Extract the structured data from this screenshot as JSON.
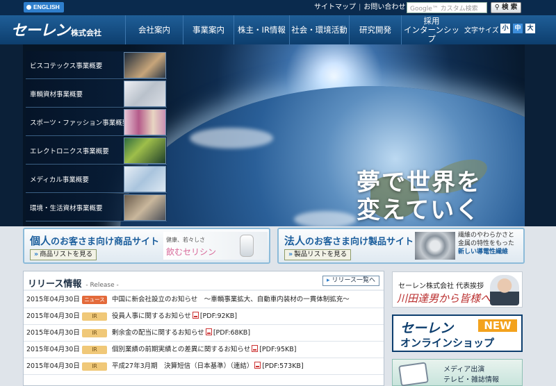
{
  "topbar": {
    "lang_label": "ENGLISH",
    "sitemap": "サイトマップ",
    "contact": "お問い合わせ",
    "search_placeholder": "Google™ カスタム検索",
    "search_button": "検 索"
  },
  "header": {
    "logo_main": "セーレン",
    "logo_sub": "株式会社",
    "nav": [
      "会社案内",
      "事業案内",
      "株主・IR情報",
      "社会・環境活動",
      "研究開発",
      "採用\nインターンシップ"
    ],
    "fontsize_label": "文字サイズ",
    "fontsize_options": [
      "小",
      "中",
      "大"
    ],
    "fontsize_selected": "中"
  },
  "hero": {
    "tagline_line1": "夢で世界を",
    "tagline_line2": "変えていく",
    "business_items": [
      "ビスコテックス事業概要",
      "車輌資材事業概要",
      "スポーツ・ファッション事業概要",
      "エレクトロニクス事業概要",
      "メディカル事業概要",
      "環境・生活資材事業概要"
    ]
  },
  "banners": {
    "personal": {
      "title_big": "個人",
      "title_rest": "のお客さま向け商品サイト",
      "button": "商品リストを見る",
      "tag1": "健康、若々しさ",
      "tag2": "飲むセリシン"
    },
    "corporate": {
      "title_big": "法人",
      "title_rest": "のお客さま向け製品サイト",
      "button": "製品リストを見る",
      "tag1": "繊維のやわらかさと",
      "tag2": "金属の特性をもった",
      "tag3": "新しい導電性繊維"
    }
  },
  "release": {
    "title": "リリース情報",
    "subtitle": "- Release -",
    "all_button": "リリース一覧へ",
    "items": [
      {
        "date": "2015年04月30日",
        "badge": "ニュース",
        "badge_type": "news",
        "text": "中国に新会社設立のお知らせ　～車輌事業拡大、自動車内装材の一貫体制拡充～",
        "pdf": ""
      },
      {
        "date": "2015年04月30日",
        "badge": "IR",
        "badge_type": "ir",
        "text": "役員人事に関するお知らせ",
        "pdf": "[PDF:92KB]"
      },
      {
        "date": "2015年04月30日",
        "badge": "IR",
        "badge_type": "ir",
        "text": "剰余金の配当に関するお知らせ",
        "pdf": "[PDF:68KB]"
      },
      {
        "date": "2015年04月30日",
        "badge": "IR",
        "badge_type": "ir",
        "text": "個別業績の前期実績との差異に関するお知らせ",
        "pdf": "[PDF:95KB]"
      },
      {
        "date": "2015年04月30日",
        "badge": "IR",
        "badge_type": "ir",
        "text": "平成27年3月期　決算短信（日本基準）（連結）",
        "pdf": "[PDF:573KB]"
      }
    ]
  },
  "sidebar": {
    "greeting_line1": "セーレン株式会社 代表挨拶",
    "greeting_line2": "川田達男から皆様へ",
    "shop_line1": "セーレン",
    "shop_new": "NEW",
    "shop_line2": "オンラインショップ",
    "media_line1": "メディア出演",
    "media_line2": "テレビ・雑誌情報"
  },
  "colors": {
    "topbar": "#0a2a4d",
    "header": "#1f5e97",
    "accent_blue": "#2f7fcd",
    "news_badge": "#e36a3b",
    "ir_badge": "#f0c878"
  },
  "icons": [
    "globe-icon",
    "search-icon",
    "pdf-icon",
    "arrow-right-icon",
    "list-icon"
  ]
}
